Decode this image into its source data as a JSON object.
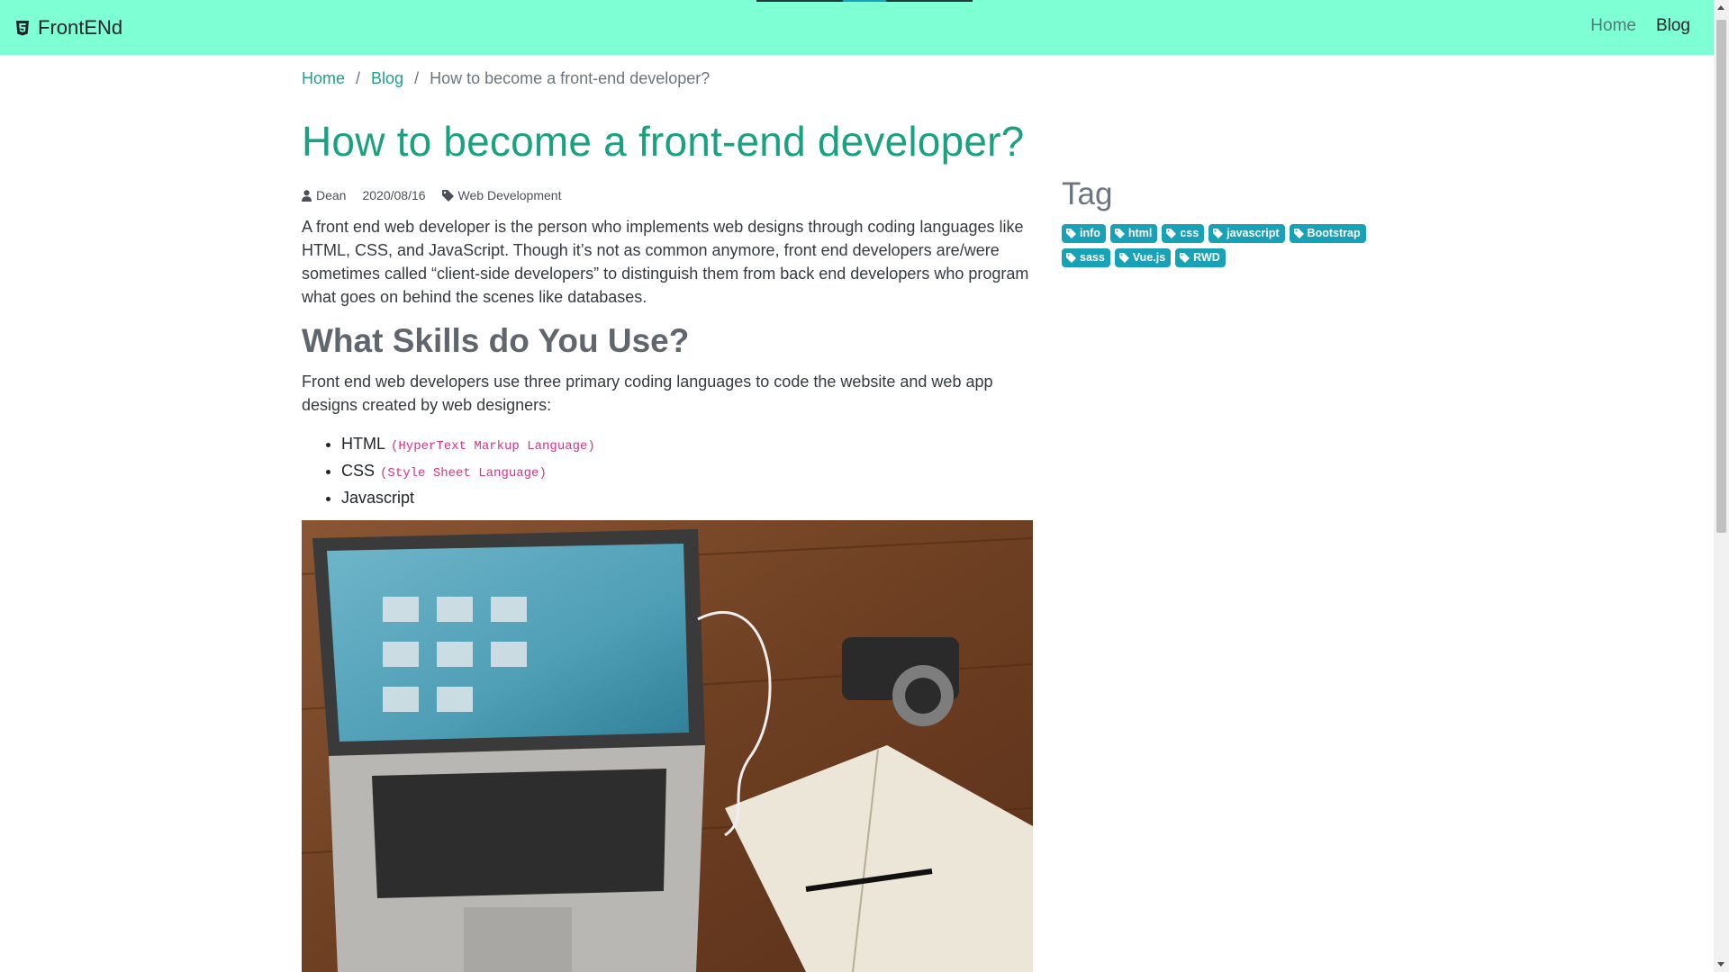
{
  "navbar": {
    "brand": "FrontENd",
    "links": [
      {
        "label": "Home"
      },
      {
        "label": "Blog"
      }
    ]
  },
  "breadcrumb": {
    "items": [
      "Home",
      "Blog"
    ],
    "current": "How to become a front-end developer?"
  },
  "post": {
    "title": "How to become a front-end developer?",
    "author": "Dean",
    "date": "2020/08/16",
    "category": "Web Development",
    "intro": "A front end web developer is the person who implements web designs through coding languages like HTML, CSS, and JavaScript. Though it’s not as common anymore, front end developers are/were sometimes called “client-side developers” to distinguish them from back end developers who program what goes on behind the scenes like databases.",
    "section_heading": "What Skills do You Use?",
    "section_text": "Front end web developers use three primary coding languages to code the website and web app designs created by web designers:",
    "skills": [
      {
        "name": "HTML",
        "note": "(HyperText Markup Language)"
      },
      {
        "name": "CSS",
        "note": "(Style Sheet Language)"
      },
      {
        "name": "Javascript",
        "note": ""
      }
    ]
  },
  "sidebar": {
    "title": "Tag",
    "tags": [
      "info",
      "html",
      "css",
      "javascript",
      "Bootstrap",
      "sass",
      "Vue.js",
      "RWD"
    ]
  },
  "colors": {
    "navbar_bg": "#7fffd4",
    "title": "#1aa180",
    "link": "#20a08a",
    "tag_bg": "#17a2b8",
    "code": "#d63384"
  },
  "icons": {
    "brand": "html5-icon",
    "author": "user-icon",
    "category": "tag-icon",
    "tag": "tag-icon"
  }
}
